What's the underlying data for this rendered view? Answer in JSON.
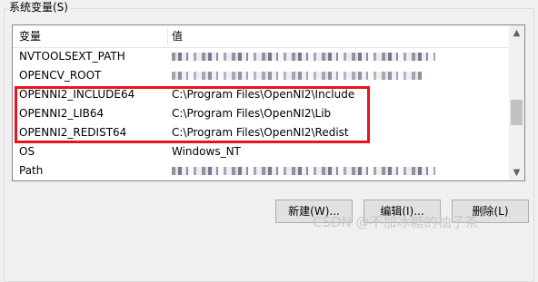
{
  "section": {
    "title": "系统变量(S)"
  },
  "table": {
    "headers": {
      "name": "变量",
      "value": "值"
    },
    "rows": [
      {
        "name": "NVTOOLSEXT_PATH",
        "value": "",
        "redacted": true
      },
      {
        "name": "OPENCV_ROOT",
        "value": "",
        "redacted": true
      },
      {
        "name": "OPENNI2_INCLUDE64",
        "value": "C:\\Program Files\\OpenNI2\\Include",
        "redacted": false
      },
      {
        "name": "OPENNI2_LIB64",
        "value": "C:\\Program Files\\OpenNI2\\Lib",
        "redacted": false
      },
      {
        "name": "OPENNI2_REDIST64",
        "value": "C:\\Program Files\\OpenNI2\\Redist",
        "redacted": false
      },
      {
        "name": "OS",
        "value": "Windows_NT",
        "redacted": false
      },
      {
        "name": "Path",
        "value": "",
        "redacted": true
      }
    ]
  },
  "buttons": {
    "new": "新建(W)...",
    "edit": "编辑(I)...",
    "delete": "删除(L)"
  },
  "watermark": "CSDN @不加冰糖的柚子茶",
  "colors": {
    "highlight_border": "#e8141c",
    "window_bg": "#f0f0f0"
  }
}
